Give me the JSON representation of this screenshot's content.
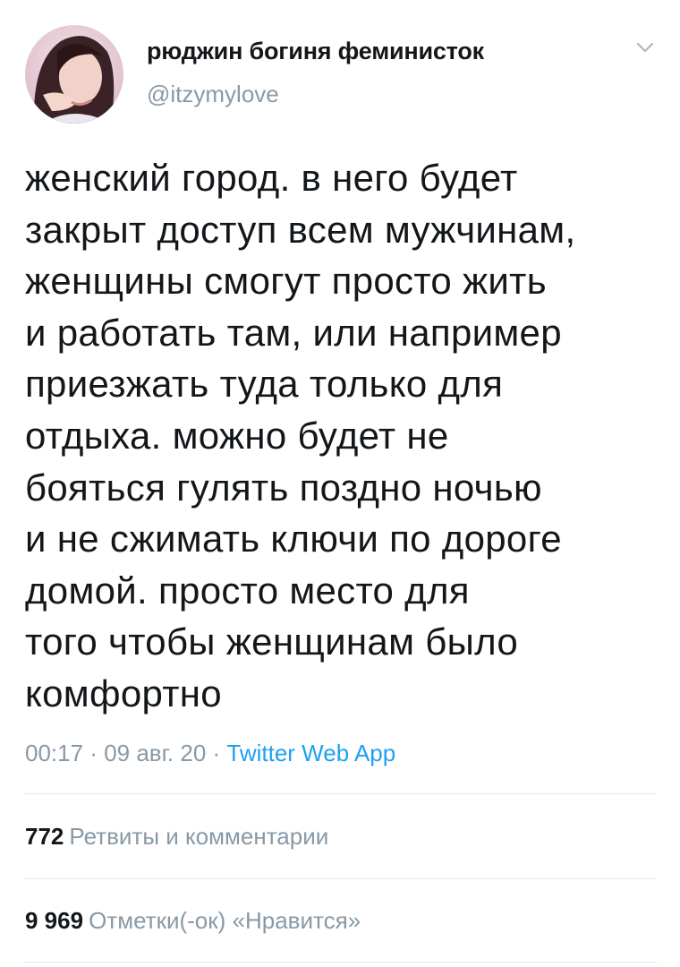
{
  "tweet": {
    "author": {
      "display_name": "рюджин богиня феминисток",
      "handle": "@itzymylove"
    },
    "menu_icon": "chevron-down-icon",
    "text_lines": [
      "женский город. в него будет",
      "закрыт доступ всем мужчинам,",
      "женщины смогут просто жить",
      "и работать там, или например",
      "приезжать туда только для",
      "отдыха. можно будет не",
      "бояться гулять поздно ночью",
      "и не сжимать ключи по дороге",
      "домой. просто место для",
      "того чтобы женщинам было",
      "комфортно"
    ],
    "meta": {
      "time": "00:17",
      "separator": " · ",
      "date": "09 авг. 20",
      "source": "Twitter Web App"
    },
    "stats": {
      "retweets_count": "772",
      "retweets_label": "Ретвиты и комментарии",
      "likes_count": "9 969",
      "likes_label": "Отметки(-ок) «Нравится»"
    }
  },
  "colors": {
    "text": "#14171a",
    "secondary": "#8899a6",
    "link": "#1da1f2",
    "divider": "#e1e8ed"
  }
}
